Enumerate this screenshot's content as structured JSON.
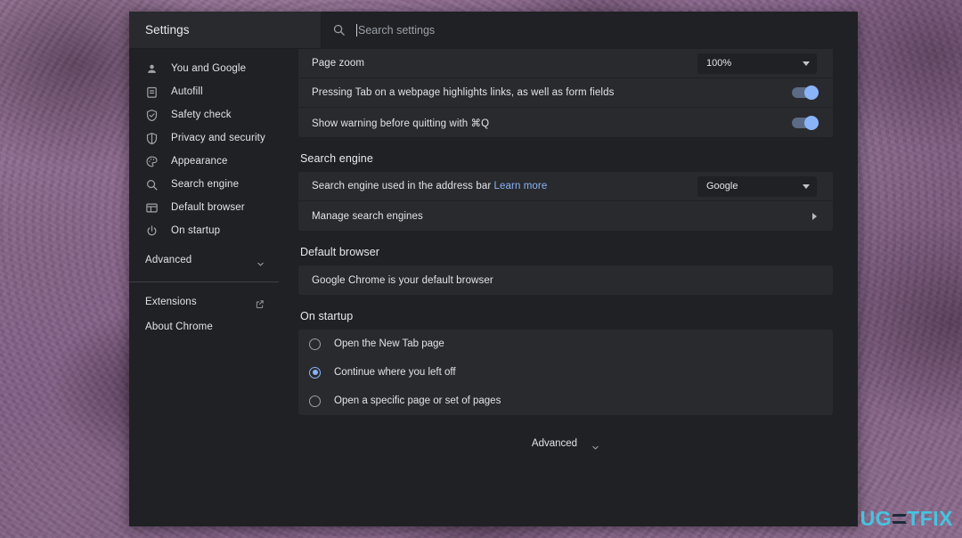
{
  "header": {
    "title": "Settings",
    "search_placeholder": "Search settings",
    "search_value": "",
    "search_icon": "search-icon"
  },
  "sidebar": {
    "items": [
      {
        "label": "You and Google",
        "icon": "person-icon"
      },
      {
        "label": "Autofill",
        "icon": "clipboard-icon"
      },
      {
        "label": "Safety check",
        "icon": "shield-check-icon"
      },
      {
        "label": "Privacy and security",
        "icon": "shield-icon"
      },
      {
        "label": "Appearance",
        "icon": "palette-icon"
      },
      {
        "label": "Search engine",
        "icon": "search-icon"
      },
      {
        "label": "Default browser",
        "icon": "window-icon"
      },
      {
        "label": "On startup",
        "icon": "power-icon"
      }
    ],
    "advanced": {
      "label": "Advanced",
      "icon": "chevron-down-icon"
    },
    "extensions": {
      "label": "Extensions",
      "icon": "external-link-icon"
    },
    "about": {
      "label": "About Chrome"
    }
  },
  "main": {
    "appearance_rows": [
      {
        "label": "Page zoom",
        "control": "dropdown",
        "value": "100%"
      },
      {
        "label": "Pressing Tab on a webpage highlights links, as well as form fields",
        "control": "toggle",
        "value": "on"
      },
      {
        "label": "Show warning before quitting with ⌘Q",
        "control": "toggle",
        "value": "on"
      }
    ],
    "search_engine": {
      "title": "Search engine",
      "row_label": "Search engine used in the address bar",
      "row_link": "Learn more",
      "selected": "Google",
      "manage_label": "Manage search engines"
    },
    "default_browser": {
      "title": "Default browser",
      "status": "Google Chrome is your default browser"
    },
    "on_startup": {
      "title": "On startup",
      "options": [
        {
          "label": "Open the New Tab page",
          "selected": false
        },
        {
          "label": "Continue where you left off",
          "selected": true
        },
        {
          "label": "Open a specific page or set of pages",
          "selected": false
        }
      ]
    },
    "advanced_footer": {
      "label": "Advanced",
      "icon": "chevron-down-icon"
    }
  },
  "watermark": {
    "part1": "UG",
    "part2": "TFIX"
  },
  "colors": {
    "accent": "#8ab4f8",
    "page_bg": "#202124",
    "card_bg": "#292a2d",
    "text": "#e2e4e7",
    "muted": "#9aa0a6",
    "watermark": "#46c4e0"
  }
}
